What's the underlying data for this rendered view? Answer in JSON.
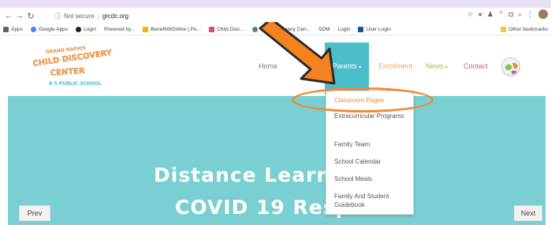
{
  "browser": {
    "security_label": "Not secure",
    "url": "grcdc.org",
    "bookmarks": [
      "Apps",
      "Google Apps",
      "Login",
      "Powered by...",
      "BenefitWOnline | Po...",
      "Child Disc...",
      "Child Discovery Cen...",
      "SDM",
      "Login",
      "User Login",
      "Other bookmarks"
    ]
  },
  "logo": {
    "line1": "GRAND RAPIDS",
    "line2": "CHILD DISCOVERY",
    "line3": "CENTER",
    "line4": "K-5 PUBLIC SCHOOL"
  },
  "nav": {
    "home": "Home",
    "parents": "Parents",
    "enrollment": "Enrollment",
    "news": "News",
    "contact": "Contact"
  },
  "dropdown": {
    "items": [
      "Classroom Pages",
      "Extracurricular Programs",
      "Family Team",
      "School Calendar",
      "School Meals",
      "Family And Student Guidebook"
    ]
  },
  "hero": {
    "title": "Distance Learn",
    "subtitle": "COVID 19 Response",
    "prev": "Prev",
    "next": "Next"
  },
  "colors": {
    "accent_teal": "#4bbecb",
    "hero_bg": "#79cfd1",
    "annotation_orange": "#ef8a33",
    "enrollment": "#f0a453",
    "news": "#8cc63f",
    "contact": "#d25b8e"
  }
}
